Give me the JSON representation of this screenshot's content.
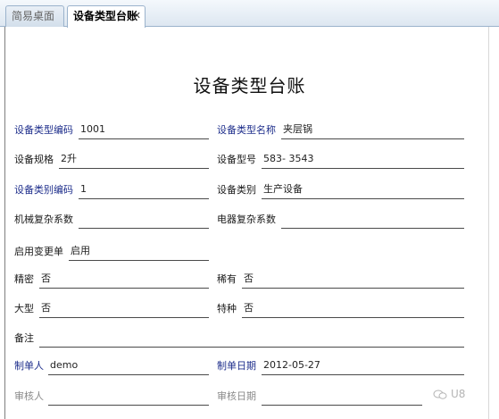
{
  "tabs": [
    {
      "label": "简易桌面"
    },
    {
      "label": "设备类型台账"
    }
  ],
  "close_glyph": "✕",
  "form": {
    "title": "设备类型台账",
    "equipment_type_code": {
      "label": "设备类型编码",
      "value": "1001"
    },
    "equipment_type_name": {
      "label": "设备类型名称",
      "value": "夹层锅"
    },
    "equipment_spec": {
      "label": "设备规格",
      "value": "2升"
    },
    "equipment_model": {
      "label": "设备型号",
      "value": "583- 3543"
    },
    "equipment_category_code": {
      "label": "设备类别编码",
      "value": "1"
    },
    "equipment_category": {
      "label": "设备类别",
      "value": "生产设备"
    },
    "mech_complexity": {
      "label": "机械复杂系数",
      "value": ""
    },
    "elec_complexity": {
      "label": "电器复杂系数",
      "value": ""
    },
    "enable_change_form": {
      "label": "启用变更单",
      "value": "启用"
    },
    "precision": {
      "label": "精密",
      "value": "否"
    },
    "rare": {
      "label": "稀有",
      "value": "否"
    },
    "large": {
      "label": "大型",
      "value": "否"
    },
    "special": {
      "label": "特种",
      "value": "否"
    },
    "remarks": {
      "label": "备注",
      "value": ""
    },
    "creator": {
      "label": "制单人",
      "value": "demo"
    },
    "create_date": {
      "label": "制单日期",
      "value": "2012-05-27"
    },
    "reviewer": {
      "label": "审核人",
      "value": ""
    },
    "review_date": {
      "label": "审核日期",
      "value": ""
    }
  },
  "watermark": {
    "text": "U8"
  },
  "colors": {
    "required_label": "#1f2f8c",
    "readonly_label": "#8a8a8a"
  }
}
